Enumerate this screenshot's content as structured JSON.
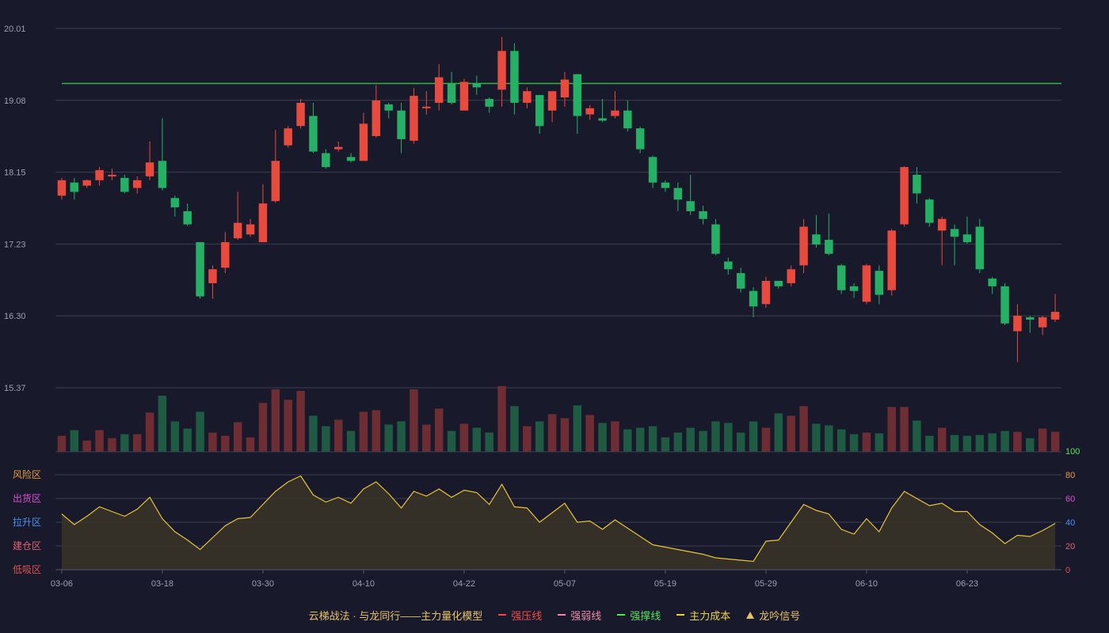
{
  "chart_data": {
    "type": "candlestick",
    "candles": [
      [
        17.85,
        18.05,
        18.08,
        17.8
      ],
      [
        18.02,
        17.9,
        18.08,
        17.8
      ],
      [
        17.98,
        18.05,
        18.06,
        17.95
      ],
      [
        18.05,
        18.18,
        18.22,
        17.98
      ],
      [
        18.1,
        18.12,
        18.2,
        18.05
      ],
      [
        18.08,
        17.9,
        18.12,
        17.88
      ],
      [
        17.95,
        18.05,
        18.1,
        17.88
      ],
      [
        18.1,
        18.28,
        18.55,
        18.05
      ],
      [
        18.3,
        17.95,
        18.85,
        17.92
      ],
      [
        17.82,
        17.7,
        17.85,
        17.58
      ],
      [
        17.65,
        17.48,
        17.75,
        17.46
      ],
      [
        17.25,
        16.55,
        17.25,
        16.52
      ],
      [
        16.72,
        16.9,
        16.95,
        16.52
      ],
      [
        16.92,
        17.25,
        17.38,
        16.85
      ],
      [
        17.3,
        17.5,
        17.9,
        17.28
      ],
      [
        17.35,
        17.48,
        17.55,
        17.32
      ],
      [
        17.25,
        17.75,
        18.0,
        17.25
      ],
      [
        17.78,
        18.3,
        18.7,
        17.76
      ],
      [
        18.5,
        18.72,
        18.75,
        18.47
      ],
      [
        18.75,
        19.05,
        19.1,
        18.72
      ],
      [
        18.88,
        18.42,
        19.05,
        18.4
      ],
      [
        18.4,
        18.22,
        18.45,
        18.2
      ],
      [
        18.45,
        18.48,
        18.55,
        18.42
      ],
      [
        18.35,
        18.3,
        18.4,
        18.28
      ],
      [
        18.3,
        18.78,
        18.92,
        18.3
      ],
      [
        18.62,
        19.08,
        19.28,
        18.6
      ],
      [
        19.03,
        18.95,
        19.05,
        18.85
      ],
      [
        18.95,
        18.58,
        19.05,
        18.4
      ],
      [
        18.56,
        19.14,
        19.24,
        18.52
      ],
      [
        19.0,
        19.0,
        19.2,
        18.9
      ],
      [
        19.05,
        19.38,
        19.55,
        18.95
      ],
      [
        19.3,
        19.05,
        19.45,
        19.03
      ],
      [
        18.95,
        19.32,
        19.36,
        18.95
      ],
      [
        19.3,
        19.25,
        19.4,
        19.15
      ],
      [
        19.1,
        19.0,
        19.12,
        18.92
      ],
      [
        19.22,
        19.72,
        19.9,
        19.0
      ],
      [
        19.72,
        19.05,
        19.82,
        18.9
      ],
      [
        19.05,
        19.2,
        19.25,
        18.98
      ],
      [
        19.15,
        18.75,
        19.15,
        18.65
      ],
      [
        18.95,
        19.2,
        19.2,
        18.8
      ],
      [
        19.12,
        19.35,
        19.45,
        19.0
      ],
      [
        19.42,
        18.88,
        19.42,
        18.65
      ],
      [
        18.9,
        18.98,
        19.02,
        18.83
      ],
      [
        18.85,
        18.82,
        19.1,
        18.8
      ],
      [
        18.88,
        18.95,
        19.2,
        18.85
      ],
      [
        18.95,
        18.72,
        19.08,
        18.68
      ],
      [
        18.72,
        18.45,
        18.74,
        18.4
      ],
      [
        18.35,
        18.02,
        18.37,
        17.95
      ],
      [
        18.02,
        17.95,
        18.05,
        17.9
      ],
      [
        17.95,
        17.8,
        18.02,
        17.65
      ],
      [
        17.78,
        17.65,
        18.12,
        17.6
      ],
      [
        17.65,
        17.55,
        17.72,
        17.48
      ],
      [
        17.48,
        17.1,
        17.55,
        17.08
      ],
      [
        17.0,
        16.9,
        17.05,
        16.83
      ],
      [
        16.85,
        16.65,
        16.92,
        16.6
      ],
      [
        16.62,
        16.42,
        16.67,
        16.28
      ],
      [
        16.45,
        16.75,
        16.8,
        16.4
      ],
      [
        16.75,
        16.68,
        16.72,
        16.65
      ],
      [
        16.72,
        16.9,
        16.95,
        16.68
      ],
      [
        16.95,
        17.45,
        17.55,
        16.85
      ],
      [
        17.35,
        17.22,
        17.6,
        17.18
      ],
      [
        17.28,
        17.1,
        17.62,
        17.08
      ],
      [
        16.95,
        16.63,
        16.97,
        16.58
      ],
      [
        16.68,
        16.62,
        16.72,
        16.53
      ],
      [
        16.48,
        16.95,
        16.97,
        16.45
      ],
      [
        16.88,
        16.57,
        16.95,
        16.45
      ],
      [
        16.63,
        17.4,
        17.42,
        16.56
      ],
      [
        17.48,
        18.22,
        18.23,
        17.45
      ],
      [
        18.12,
        17.88,
        18.22,
        17.75
      ],
      [
        17.8,
        17.5,
        17.82,
        17.45
      ],
      [
        17.4,
        17.55,
        17.58,
        16.95
      ],
      [
        17.42,
        17.32,
        17.48,
        16.95
      ],
      [
        17.35,
        17.25,
        17.58,
        17.23
      ],
      [
        17.45,
        16.9,
        17.55,
        16.85
      ],
      [
        16.78,
        16.68,
        16.8,
        16.58
      ],
      [
        16.68,
        16.2,
        16.72,
        16.18
      ],
      [
        16.1,
        16.3,
        16.45,
        15.7
      ],
      [
        16.28,
        16.25,
        16.3,
        16.08
      ],
      [
        16.15,
        16.28,
        16.3,
        16.05
      ],
      [
        16.25,
        16.35,
        16.58,
        16.22
      ]
    ],
    "volume": [
      20,
      27,
      14,
      27,
      17,
      22,
      22,
      49,
      70,
      38,
      29,
      50,
      24,
      20,
      37,
      18,
      61,
      78,
      65,
      76,
      45,
      32,
      40,
      26,
      50,
      52,
      34,
      38,
      78,
      34,
      54,
      26,
      35,
      30,
      24,
      82,
      57,
      32,
      38,
      47,
      42,
      58,
      46,
      36,
      38,
      28,
      30,
      32,
      18,
      24,
      30,
      26,
      38,
      36,
      24,
      38,
      30,
      48,
      45,
      57,
      35,
      33,
      28,
      22,
      24,
      23,
      56,
      56,
      39,
      20,
      30,
      21,
      20,
      21,
      23,
      26,
      25,
      17,
      29,
      25
    ],
    "dates": [
      "03-06",
      "03-18",
      "03-30",
      "04-10",
      "04-22",
      "05-07",
      "05-19",
      "05-29",
      "06-10",
      "06-23"
    ],
    "y_ticks": [
      "20.01",
      "19.08",
      "18.15",
      "17.23",
      "16.30",
      "15.37"
    ],
    "ylim": [
      15.37,
      20.01
    ],
    "resistance_line": 19.3,
    "indicator": {
      "values": [
        47,
        38,
        45,
        53,
        49,
        45,
        51,
        61,
        43,
        32,
        25,
        17,
        27,
        37,
        43,
        44,
        55,
        66,
        74,
        79,
        63,
        57,
        61,
        56,
        68,
        74,
        64,
        52,
        66,
        62,
        68,
        61,
        67,
        65,
        55,
        72,
        53,
        52,
        40,
        48,
        56,
        40,
        41,
        34,
        42,
        35,
        28,
        21,
        19,
        17,
        15,
        13,
        10,
        9,
        8,
        7,
        24,
        25,
        40,
        55,
        50,
        47,
        34,
        30,
        43,
        32,
        52,
        66,
        60,
        54,
        56,
        49,
        49,
        38,
        31,
        22,
        29,
        28,
        33,
        39
      ],
      "ylim": [
        0,
        100
      ],
      "y_ticks": [
        "100",
        "80",
        "60",
        "40",
        "20",
        "0"
      ],
      "zones": [
        {
          "label": "风险区",
          "color": "#e89a3c"
        },
        {
          "label": "出货区",
          "color": "#d84fd8"
        },
        {
          "label": "拉升区",
          "color": "#4a8ff0"
        },
        {
          "label": "建仓区",
          "color": "#e06070"
        },
        {
          "label": "低吸区",
          "color": "#e05050"
        }
      ]
    },
    "legend": {
      "title": "云梯战法 · 与龙同行——主力量化模型",
      "items": [
        {
          "label": "强压线",
          "color": "#ef4b4b"
        },
        {
          "label": "强弱线",
          "color": "#f08aa8"
        },
        {
          "label": "强撑线",
          "color": "#58e058"
        },
        {
          "label": "主力成本",
          "color": "#e8d24a"
        },
        {
          "label": "龙吟信号",
          "color": "#e8c16a"
        }
      ]
    },
    "colors": {
      "up": "#e84a3e",
      "down": "#26b066",
      "vol_up": "#6e2d33",
      "vol_down": "#1f5a43",
      "line": "#e8c23a",
      "support": "#3fae4f"
    }
  }
}
